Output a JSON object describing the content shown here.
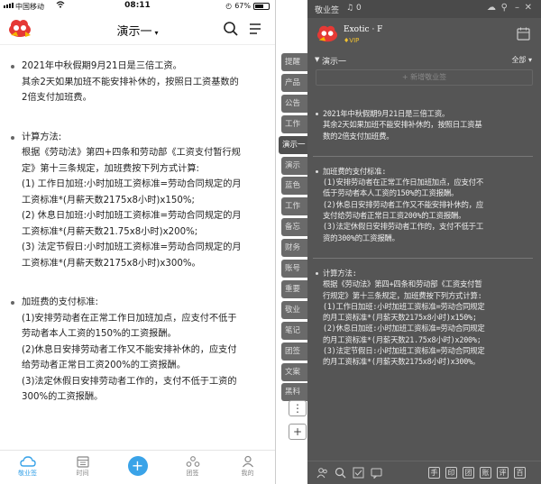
{
  "status_bar": {
    "carrier": "中国移动",
    "time": "08:11",
    "battery": "67%",
    "battery_level": 0.67
  },
  "header": {
    "title": "演示一"
  },
  "notes": [
    {
      "lines": [
        "2021年中秋假期9月21日是三倍工资。",
        "其余2天如果加班不能安排补休的，按照日工资基数的",
        "2倍支付加班费。"
      ]
    },
    {
      "lines": [
        "计算方法:",
        "根据《劳动法》第四+四条和劳动部《工资支付暂行规",
        "定》第十三条规定，加班费按下列方式计算:",
        "(1) 工作日加班:小时加班工资标准=劳动合同规定的月",
        "工资标准*(月薪天数2175x8小时)x150%;",
        "(2) 休息日加班:小时加班工资标准=劳动合同规定的月",
        "工资标准*(月薪天数21.75x8小时)x200%;",
        "(3) 法定节假日:小时加班工资标准=劳动合同规定的月",
        "工资标准*(月薪天数2175x8小时)x300%。"
      ]
    },
    {
      "lines": [
        "加班费的支付标准:",
        "(1)安排劳动者在正常工作日加班加点，应支付不低于",
        "劳动者本人工资的150%的工资报酬。",
        "(2)休息日安排劳动者工作又不能安排补休的，应支付",
        "给劳动者正常日工资200%的工资报酬。",
        "(3)法定休假日安排劳动者工作的，支付不低于工资的",
        "300%的工资报酬。"
      ]
    }
  ],
  "tabbar": {
    "items": [
      {
        "label": "敬业签",
        "icon": "cloud-icon"
      },
      {
        "label": "时间",
        "icon": "calendar-icon"
      },
      {
        "label": "团签",
        "icon": "group-icon"
      },
      {
        "label": "我的",
        "icon": "user-icon"
      }
    ],
    "add": "+"
  },
  "side_tabs": {
    "items": [
      "提醒",
      "产品",
      "公告",
      "工作",
      "演示一",
      "演示",
      "蓝色",
      "工作",
      "备忘",
      "财务",
      "账号",
      "重要",
      "敬业",
      "笔记",
      "团签",
      "文案",
      "黑科"
    ],
    "more": "⋮",
    "add": "+"
  },
  "desktop": {
    "app_name": "敬业签",
    "notification_count": "0",
    "user_name": "Exotic · F",
    "vip": "VIP",
    "category": "演示一",
    "filter": "全部",
    "new_note": "+ 新增敬业签",
    "notes": [
      {
        "lines": [
          "2021年中秋假期9月21日是三倍工资。",
          "其余2天如果加班不能安排补休的，按照日工资基",
          "数的2倍支付加班费。"
        ]
      },
      {
        "lines": [
          "加班费的支付标准:",
          "(1)安排劳动者在正常工作日加班加点，应支付不",
          "低于劳动者本人工资的150%的工资报酬。",
          "(2)休息日安排劳动者工作又不能安排补休的，应",
          "支付给劳动者正常日工资200%的工资报酬。",
          "(3)法定休假日安排劳动者工作的，支付不低于工",
          "资的300%的工资报酬。"
        ]
      },
      {
        "lines": [
          "计算方法:",
          "根据《劳动法》第四+四条和劳动部《工资支付暂",
          "行规定》第十三条规定，加班费按下列方式计算:",
          "(1)工作日加班:小时加班工资标准=劳动合同规定",
          "的月工资标准*(月薪天数2175x8小时)x150%;",
          "(2)休息日加班:小时加班工资标准=劳动合同规定",
          "的月工资标准*(月薪天数21.75x8小时)x200%;",
          "(3)法定节假日:小时加班工资标准=劳动合同规定",
          "的月工资标准*(月薪天数2175x8小时)x300%。"
        ]
      }
    ],
    "bottom_chars": [
      "手",
      "印",
      "团",
      "账",
      "评",
      "百"
    ]
  },
  "colors": {
    "accent": "#3aa3e8",
    "brand_red": "#e53935",
    "desktop_bg": "#555555",
    "vip_gold": "#f2c230"
  }
}
